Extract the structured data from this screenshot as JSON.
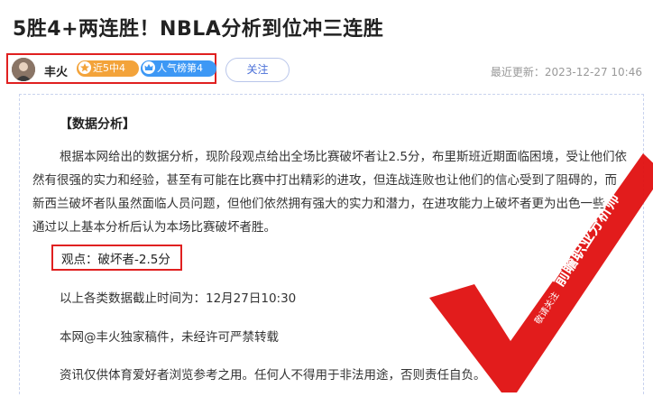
{
  "header": {
    "title": "5胜4+两连胜！NBLA分析到位冲三连胜"
  },
  "author": {
    "name": "丰火",
    "badges": [
      {
        "label": "近5中4",
        "icon": "star-icon",
        "color": "#f3a33a"
      },
      {
        "label": "人气榜第4",
        "icon": "crown-icon",
        "color": "#3d98f5"
      }
    ],
    "follow_label": "关注"
  },
  "update_time": "最近更新：2023-12-27 10:46",
  "article": {
    "section_title": "【数据分析】",
    "analysis": "根据本网给出的数据分析，现阶段观点给出全场比赛破坏者让2.5分，布里斯班近期面临困境，受让他们依然有很强的实力和经验，甚至有可能在比赛中打出精彩的进攻，但连战连败也让他们的信心受到了阻碍的，而新西兰破坏者队虽然面临人员问题，但他们依然拥有强大的实力和潜力，在进攻能力上破坏者更为出色一些，通过以上基本分析后认为本场比赛破坏者胜。",
    "viewpoint": "观点：破坏者-2.5分",
    "deadline": "以上各类数据截止时间为：12月27日10:30",
    "copyright": "本网@丰火独家稿件，未经许可严禁转载",
    "disclaimer": "资讯仅供体育爱好者浏览参考之用。任何人不得用于非法用途，否则责任自负。"
  },
  "stamp": {
    "small_text": "敬请关注",
    "main_text": "前瞻职业分析师",
    "color": "#e01010"
  }
}
